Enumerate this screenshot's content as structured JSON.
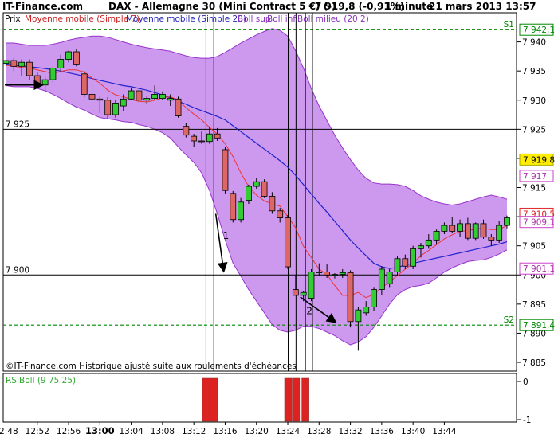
{
  "header": {
    "site": "IT-Finance.com",
    "instrument": "DAX - Allemagne 30 (Mini Contract 5 €) (-)",
    "quote": "7 919,8 (-0,91%)",
    "interval": "1 minute",
    "datetime": "21 mars 2013 13:57"
  },
  "legend": {
    "prix": "Prix",
    "mm7": "Moyenne mobile (Simple 7)",
    "mm20": "Moyenne mobile (Simple 20)",
    "boll_sup": "Boll sup",
    "boll_inf": "Boll inf",
    "boll_mid": "Boll milieu (20 2)"
  },
  "footer_note": "©IT-Finance.com Historique ajusté suite aux roulements d'échéances",
  "colors": {
    "band_fill": "#cc99ee",
    "band_edge": "#9933cc",
    "up_candle": "#33cc33",
    "down_candle": "#dd6666",
    "mm7": "#ee3333",
    "mm20": "#2222cc",
    "support_line": "#008800",
    "price_box": "#ffee00",
    "annotation_boxes": "#cc44cc",
    "rsiboll_bars": "#dd2222"
  },
  "chart_data": [
    {
      "type": "candlestick",
      "y_axis_ticks": [
        7885,
        7890,
        7895,
        7900,
        7905,
        7910,
        7915,
        7920,
        7925,
        7930,
        7935,
        7940
      ],
      "y_tick_labels": [
        "7 885",
        "7 890",
        "7 895",
        "7 900",
        "7 905",
        "7 910",
        "7 915",
        "7 920",
        "7 925",
        "7 930",
        "7 935",
        "7 940"
      ],
      "ylim": [
        7883.5,
        7945
      ],
      "x_tick_labels": [
        "12:48",
        "12:52",
        "12:56",
        "13:00",
        "13:04",
        "13:08",
        "13:12",
        "13:16",
        "13:20",
        "13:24",
        "13:28",
        "13:32",
        "13:36",
        "13:40",
        "13:44"
      ],
      "x_tick_index": [
        0,
        4,
        8,
        12,
        16,
        20,
        24,
        28,
        32,
        36,
        40,
        44,
        48,
        52,
        56
      ],
      "bold_tick": "13:00",
      "candles": [
        {
          "o": 7936.3,
          "h": 7937.5,
          "l": 7935.2,
          "c": 7936.8
        },
        {
          "o": 7936.8,
          "h": 7937.2,
          "l": 7935.0,
          "c": 7935.8
        },
        {
          "o": 7935.8,
          "h": 7937.0,
          "l": 7934.2,
          "c": 7936.5
        },
        {
          "o": 7936.5,
          "h": 7937.0,
          "l": 7933.5,
          "c": 7934.2
        },
        {
          "o": 7934.2,
          "h": 7934.8,
          "l": 7932.0,
          "c": 7932.6
        },
        {
          "o": 7932.6,
          "h": 7934.0,
          "l": 7931.4,
          "c": 7933.5
        },
        {
          "o": 7933.5,
          "h": 7935.8,
          "l": 7933.0,
          "c": 7935.5
        },
        {
          "o": 7935.5,
          "h": 7937.8,
          "l": 7935.0,
          "c": 7937.0
        },
        {
          "o": 7937.0,
          "h": 7938.5,
          "l": 7936.5,
          "c": 7938.3
        },
        {
          "o": 7938.3,
          "h": 7938.8,
          "l": 7935.8,
          "c": 7936.2
        },
        {
          "o": 7934.5,
          "h": 7935.0,
          "l": 7930.5,
          "c": 7931.0
        },
        {
          "o": 7931.0,
          "h": 7932.8,
          "l": 7930.5,
          "c": 7930.2
        },
        {
          "o": 7930.2,
          "h": 7930.6,
          "l": 7927.8,
          "c": 7930.0
        },
        {
          "o": 7930.0,
          "h": 7930.5,
          "l": 7926.8,
          "c": 7927.5
        },
        {
          "o": 7927.5,
          "h": 7930.0,
          "l": 7927.0,
          "c": 7929.5
        },
        {
          "o": 7929.0,
          "h": 7931.0,
          "l": 7928.2,
          "c": 7930.2
        },
        {
          "o": 7930.2,
          "h": 7932.0,
          "l": 7930.0,
          "c": 7931.6
        },
        {
          "o": 7931.6,
          "h": 7932.0,
          "l": 7929.6,
          "c": 7930.0
        },
        {
          "o": 7930.0,
          "h": 7930.8,
          "l": 7929.4,
          "c": 7930.3
        },
        {
          "o": 7930.3,
          "h": 7932.5,
          "l": 7930.0,
          "c": 7931.0
        },
        {
          "o": 7930.3,
          "h": 7931.5,
          "l": 7930.0,
          "c": 7931.0
        },
        {
          "o": 7930.0,
          "h": 7931.0,
          "l": 7929.0,
          "c": 7930.3
        },
        {
          "o": 7930.2,
          "h": 7930.6,
          "l": 7927.0,
          "c": 7927.3
        },
        {
          "o": 7925.5,
          "h": 7926.0,
          "l": 7923.6,
          "c": 7924.0
        },
        {
          "o": 7923.8,
          "h": 7924.2,
          "l": 7922.0,
          "c": 7923.0
        },
        {
          "o": 7923.0,
          "h": 7924.6,
          "l": 7922.5,
          "c": 7922.9
        },
        {
          "o": 7922.9,
          "h": 7925.5,
          "l": 7922.5,
          "c": 7924.2
        },
        {
          "o": 7924.2,
          "h": 7925.2,
          "l": 7923.0,
          "c": 7923.5
        },
        {
          "o": 7921.5,
          "h": 7922.0,
          "l": 7914.0,
          "c": 7914.5
        },
        {
          "o": 7914.0,
          "h": 7914.4,
          "l": 7909.0,
          "c": 7909.5
        },
        {
          "o": 7909.5,
          "h": 7913.2,
          "l": 7909.0,
          "c": 7912.5
        },
        {
          "o": 7912.8,
          "h": 7915.5,
          "l": 7912.2,
          "c": 7915.2
        },
        {
          "o": 7915.2,
          "h": 7916.6,
          "l": 7914.8,
          "c": 7916.0
        },
        {
          "o": 7916.0,
          "h": 7916.4,
          "l": 7913.2,
          "c": 7913.5
        },
        {
          "o": 7913.5,
          "h": 7914.2,
          "l": 7910.5,
          "c": 7911.0
        },
        {
          "o": 7911.0,
          "h": 7911.5,
          "l": 7909.0,
          "c": 7909.8
        },
        {
          "o": 7909.8,
          "h": 7910.3,
          "l": 7901.0,
          "c": 7901.4
        },
        {
          "o": 7897.5,
          "h": 7900.0,
          "l": 7896.5,
          "c": 7896.5
        },
        {
          "o": 7896.5,
          "h": 7897.2,
          "l": 7895.5,
          "c": 7897.0
        },
        {
          "o": 7896.0,
          "h": 7901.0,
          "l": 7895.5,
          "c": 7900.5
        },
        {
          "o": 7900.5,
          "h": 7902.0,
          "l": 7899.8,
          "c": 7900.5
        },
        {
          "o": 7900.5,
          "h": 7901.8,
          "l": 7899.5,
          "c": 7900.0
        },
        {
          "o": 7900.0,
          "h": 7900.3,
          "l": 7899.4,
          "c": 7900.1
        },
        {
          "o": 7900.1,
          "h": 7901.0,
          "l": 7899.5,
          "c": 7900.4
        },
        {
          "o": 7900.4,
          "h": 7900.8,
          "l": 7891.0,
          "c": 7892.0
        },
        {
          "o": 7892.0,
          "h": 7894.5,
          "l": 7887.0,
          "c": 7894.0
        },
        {
          "o": 7893.5,
          "h": 7895.5,
          "l": 7893.0,
          "c": 7894.5
        },
        {
          "o": 7894.5,
          "h": 7897.8,
          "l": 7893.8,
          "c": 7897.5
        },
        {
          "o": 7897.5,
          "h": 7901.5,
          "l": 7896.5,
          "c": 7901.0
        },
        {
          "o": 7898.5,
          "h": 7901.0,
          "l": 7897.8,
          "c": 7900.5
        },
        {
          "o": 7900.5,
          "h": 7903.2,
          "l": 7899.8,
          "c": 7902.8
        },
        {
          "o": 7902.8,
          "h": 7903.5,
          "l": 7901.0,
          "c": 7901.5
        },
        {
          "o": 7901.5,
          "h": 7905.0,
          "l": 7901.0,
          "c": 7904.5
        },
        {
          "o": 7904.5,
          "h": 7905.5,
          "l": 7903.0,
          "c": 7905.0
        },
        {
          "o": 7905.0,
          "h": 7907.0,
          "l": 7904.5,
          "c": 7906.0
        },
        {
          "o": 7906.0,
          "h": 7907.8,
          "l": 7905.2,
          "c": 7907.5
        },
        {
          "o": 7907.5,
          "h": 7909.0,
          "l": 7907.0,
          "c": 7908.5
        },
        {
          "o": 7908.5,
          "h": 7910.0,
          "l": 7907.2,
          "c": 7907.5
        },
        {
          "o": 7907.5,
          "h": 7909.5,
          "l": 7906.5,
          "c": 7908.8
        },
        {
          "o": 7908.8,
          "h": 7909.8,
          "l": 7906.0,
          "c": 7906.3
        },
        {
          "o": 7906.3,
          "h": 7909.0,
          "l": 7906.0,
          "c": 7908.8
        },
        {
          "o": 7908.8,
          "h": 7909.5,
          "l": 7906.2,
          "c": 7906.5
        },
        {
          "o": 7906.5,
          "h": 7907.0,
          "l": 7905.0,
          "c": 7906.0
        },
        {
          "o": 7906.0,
          "h": 7909.2,
          "l": 7905.5,
          "c": 7908.5
        },
        {
          "o": 7908.5,
          "h": 7910.2,
          "l": 7908.0,
          "c": 7909.8
        }
      ],
      "mm7": [
        7936.0,
        7935.8,
        7935.6,
        7935.5,
        7935.2,
        7934.9,
        7934.6,
        7934.9,
        7935.2,
        7935.2,
        7934.8,
        7933.8,
        7932.9,
        7931.7,
        7930.9,
        7930.6,
        7930.1,
        7929.8,
        7929.7,
        7930.0,
        7930.4,
        7930.6,
        7930.0,
        7928.7,
        7927.6,
        7926.6,
        7925.3,
        7924.2,
        7922.5,
        7920.3,
        7917.5,
        7915.2,
        7913.7,
        7912.7,
        7912.2,
        7911.8,
        7910.0,
        7908.1,
        7904.9,
        7903.0,
        7901.0,
        7900.1,
        7898.2,
        7896.5,
        7896.5,
        7897.0,
        7896.1,
        7896.7,
        7897.8,
        7898.8,
        7899.9,
        7901.0,
        7902.0,
        7903.3,
        7904.2,
        7905.2,
        7906.2,
        7906.9,
        7907.5,
        7907.6,
        7907.9,
        7908.0,
        7907.8,
        7907.8,
        7908.5
      ],
      "mm20": [
        7936.2,
        7936.0,
        7935.9,
        7935.7,
        7935.6,
        7935.4,
        7935.2,
        7935.0,
        7934.7,
        7934.4,
        7934.1,
        7933.7,
        7933.4,
        7933.1,
        7932.8,
        7932.5,
        7932.3,
        7932.0,
        7931.7,
        7931.3,
        7930.9,
        7930.4,
        7929.8,
        7929.3,
        7928.7,
        7928.2,
        7927.7,
        7927.2,
        7926.6,
        7925.6,
        7924.6,
        7923.6,
        7922.6,
        7921.6,
        7920.6,
        7919.6,
        7918.5,
        7917.1,
        7915.5,
        7913.9,
        7912.3,
        7910.8,
        7909.2,
        7907.6,
        7906.0,
        7904.6,
        7903.3,
        7902.0,
        7901.4,
        7901.1,
        7901.3,
        7901.7,
        7902.0,
        7902.3,
        7902.6,
        7902.9,
        7903.2,
        7903.5,
        7903.8,
        7904.1,
        7904.4,
        7904.7,
        7905.0,
        7905.3,
        7905.7
      ],
      "boll_sup": [
        7939.8,
        7939.8,
        7939.6,
        7939.4,
        7939.4,
        7939.4,
        7939.6,
        7939.9,
        7940.3,
        7940.6,
        7940.8,
        7941.0,
        7941.0,
        7940.8,
        7940.4,
        7940.0,
        7939.6,
        7939.3,
        7939.0,
        7938.8,
        7938.6,
        7938.4,
        7938.0,
        7937.6,
        7937.3,
        7937.2,
        7937.2,
        7937.5,
        7938.2,
        7939.0,
        7939.8,
        7940.5,
        7941.2,
        7941.8,
        7942.3,
        7942.0,
        7941.0,
        7938.5,
        7935.5,
        7932.0,
        7929.0,
        7926.5,
        7924.0,
        7921.8,
        7919.8,
        7918.0,
        7916.6,
        7915.8,
        7915.6,
        7915.6,
        7915.5,
        7915.2,
        7914.5,
        7913.6,
        7913.0,
        7912.5,
        7912.2,
        7912.0,
        7912.2,
        7912.6,
        7913.0,
        7913.4,
        7913.7,
        7913.4,
        7913.0
      ],
      "boll_inf": [
        7932.5,
        7932.3,
        7932.3,
        7932.3,
        7932.0,
        7931.6,
        7931.0,
        7930.3,
        7929.5,
        7928.8,
        7928.3,
        7927.6,
        7927.0,
        7926.8,
        7926.6,
        7926.3,
        7926.2,
        7925.8,
        7925.5,
        7925.0,
        7924.4,
        7923.5,
        7922.0,
        7920.6,
        7919.3,
        7917.5,
        7914.5,
        7910.5,
        7906.0,
        7902.0,
        7899.8,
        7897.5,
        7895.5,
        7893.5,
        7891.5,
        7890.5,
        7890.2,
        7890.5,
        7891.2,
        7891.2,
        7890.8,
        7890.2,
        7889.6,
        7888.7,
        7888.0,
        7888.5,
        7889.4,
        7891.0,
        7893.0,
        7895.0,
        7896.6,
        7897.5,
        7898.0,
        7898.2,
        7898.6,
        7899.5,
        7900.5,
        7901.2,
        7901.8,
        7902.3,
        7902.5,
        7902.6,
        7903.0,
        7903.6,
        7904.3
      ],
      "hlines": [
        {
          "value": 7925.0,
          "label": "7 925",
          "style": "solid"
        },
        {
          "value": 7900.0,
          "label": "7 900",
          "style": "solid"
        },
        {
          "value": 7942.1,
          "label": "S1",
          "style": "dashed"
        },
        {
          "value": 7891.4,
          "label": "S2",
          "style": "dashed"
        }
      ],
      "vlines_index": [
        25.5,
        26.5,
        36,
        37,
        38.2,
        39.1
      ],
      "price_labels": [
        {
          "value": 7942.1,
          "text": "7 942,1",
          "kind": "green"
        },
        {
          "value": 7919.8,
          "text": "7 919,8",
          "kind": "current"
        },
        {
          "value": 7917.0,
          "text": "7 917",
          "kind": "magenta"
        },
        {
          "value": 7910.5,
          "text": "7 910,5",
          "kind": "red"
        },
        {
          "value": 7909.1,
          "text": "7 909,1",
          "kind": "magenta"
        },
        {
          "value": 7901.1,
          "text": "7 901,1",
          "kind": "magenta"
        },
        {
          "value": 7891.4,
          "text": "7 891,4",
          "kind": "green"
        }
      ],
      "annotations": [
        {
          "label": "1",
          "from_index": 26.8,
          "from_value": 7910.5,
          "to_index": 27.8,
          "to_value": 7900.8
        },
        {
          "label": "2",
          "from_index": 37.6,
          "from_value": 7896.2,
          "to_index": 42.0,
          "to_value": 7892.0
        }
      ]
    },
    {
      "type": "bar",
      "title": "RSIBoll (9 75 25)",
      "y_tick_labels": [
        "0",
        "-1"
      ],
      "bars_index": [
        25.5,
        26.5,
        36,
        37,
        38.2
      ],
      "values": [
        -1,
        -1,
        -1,
        -1,
        -1
      ]
    }
  ]
}
